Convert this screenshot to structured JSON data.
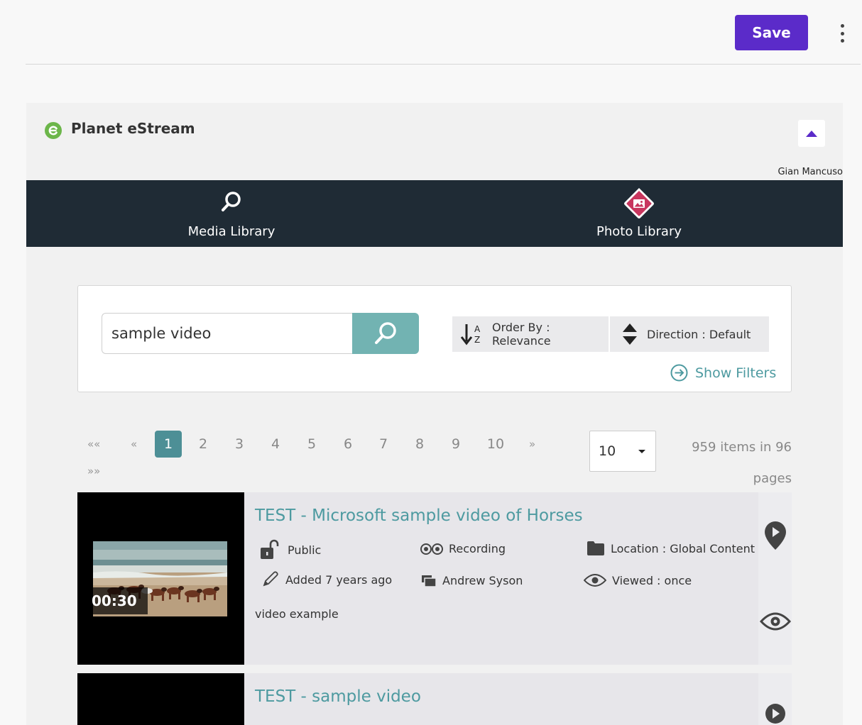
{
  "toolbar": {
    "save_label": "Save"
  },
  "block": {
    "title": "Planet eStream",
    "user_name": "Gian Mancuso",
    "nav": [
      {
        "label": "Media Library",
        "icon": "search-icon"
      },
      {
        "label": "Photo Library",
        "icon": "photo-icon"
      }
    ],
    "search": {
      "value": "sample video",
      "order_label": "Order By : Relevance",
      "direction_label": "Direction : Default",
      "show_filters": "Show Filters"
    },
    "pagination": {
      "first": "««",
      "prev": "«",
      "pages": [
        "1",
        "2",
        "3",
        "4",
        "5",
        "6",
        "7",
        "8",
        "9",
        "10"
      ],
      "active_page": "1",
      "next": "»",
      "last": "»»",
      "per_page": "10",
      "items_line1": "959 items in 96",
      "items_line2": "pages"
    },
    "results": [
      {
        "title": "TEST - Microsoft sample video of Horses",
        "duration": "00:30",
        "visibility": "Public",
        "type": "Recording",
        "location": "Location : Global Content",
        "added": "Added 7 years ago",
        "author": "Andrew Syson",
        "viewed": "Viewed : once",
        "description": "video example"
      },
      {
        "title": "TEST - sample video"
      }
    ]
  },
  "colors": {
    "accent": "#5b2bc9",
    "teal": "#4d9aa0",
    "navbar": "#1f2b35",
    "photo_icon": "#c8365e"
  }
}
